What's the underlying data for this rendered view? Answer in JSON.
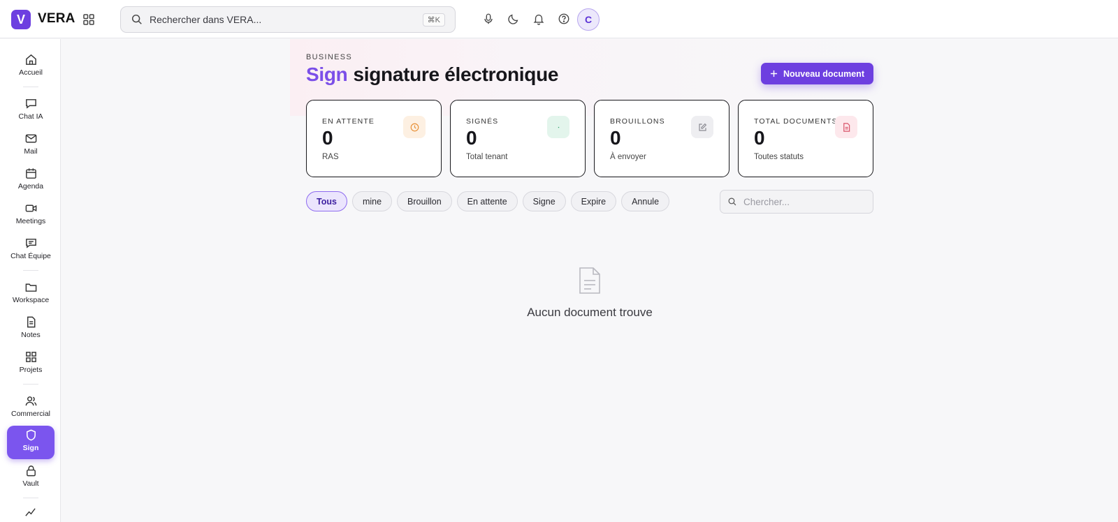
{
  "app": {
    "logo_letter": "V",
    "name": "VERA"
  },
  "topbar": {
    "search_placeholder": "Rechercher dans VERA...",
    "shortcut": "⌘K",
    "avatar_initial": "C"
  },
  "sidebar": {
    "items": [
      {
        "label": "Accueil",
        "icon": "home-icon"
      },
      {
        "label": "Chat IA",
        "icon": "chat-icon"
      },
      {
        "label": "Mail",
        "icon": "mail-icon"
      },
      {
        "label": "Agenda",
        "icon": "calendar-icon"
      },
      {
        "label": "Meetings",
        "icon": "video-icon"
      },
      {
        "label": "Chat Équipe",
        "icon": "team-chat-icon"
      },
      {
        "label": "Workspace",
        "icon": "folder-icon"
      },
      {
        "label": "Notes",
        "icon": "note-icon"
      },
      {
        "label": "Projets",
        "icon": "grid-icon"
      },
      {
        "label": "Commercial",
        "icon": "users-icon"
      },
      {
        "label": "Sign",
        "icon": "shield-icon",
        "active": true
      },
      {
        "label": "Vault",
        "icon": "lock-icon"
      }
    ]
  },
  "header": {
    "kicker": "BUSINESS",
    "title_accent": "Sign",
    "title_rest": "signature électronique",
    "new_button": "Nouveau document"
  },
  "stats": [
    {
      "label": "EN ATTENTE",
      "value": "0",
      "sub": "RAS",
      "icon": "clock-icon",
      "color": "#e8923a"
    },
    {
      "label": "SIGNÉS",
      "value": "0",
      "sub": "Total tenant",
      "icon": "check-icon",
      "color": "#2fa36b"
    },
    {
      "label": "BROUILLONS",
      "value": "0",
      "sub": "À envoyer",
      "icon": "edit-icon",
      "color": "#8a8a92"
    },
    {
      "label": "TOTAL DOCUMENTS",
      "value": "0",
      "sub": "Toutes statuts",
      "icon": "document-icon",
      "color": "#d9546a"
    }
  ],
  "filters": {
    "chips": [
      "Tous",
      "mine",
      "Brouillon",
      "En attente",
      "Signe",
      "Expire",
      "Annule"
    ],
    "active": "Tous",
    "search_placeholder": "Chercher..."
  },
  "empty_state": {
    "message": "Aucun document trouve"
  },
  "colors": {
    "accent": "#6d3fe0",
    "accent_light": "#7b55ee"
  }
}
